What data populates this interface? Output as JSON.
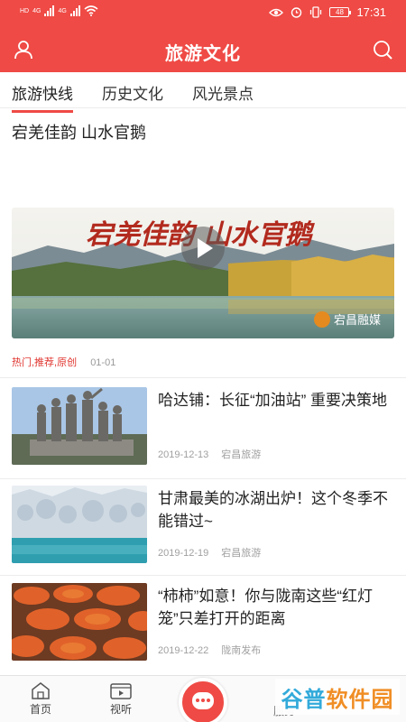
{
  "status": {
    "carrier_left": "HD",
    "net1": "4G",
    "net2": "4G",
    "battery": "48",
    "time": "17:31"
  },
  "header": {
    "title": "旅游文化",
    "left_icon": "user-icon",
    "right_icon": "search-icon"
  },
  "tabs": [
    {
      "label": "旅游快线",
      "active": true
    },
    {
      "label": "历史文化",
      "active": false
    },
    {
      "label": "风光景点",
      "active": false
    }
  ],
  "featured": {
    "title": "宕羌佳韵 山水官鹅",
    "banner_text": "宕羌佳韵 山水官鹅",
    "watermark": "宕昌融媒",
    "tags": "热门,推荐,原创",
    "date": "01-01"
  },
  "news": [
    {
      "title": "哈达铺：长征“加油站” 重要决策地",
      "date": "2019-12-13",
      "source": "宕昌旅游",
      "thumb": "statues"
    },
    {
      "title": "甘肃最美的冰湖出炉！这个冬季不能错过~",
      "date": "2019-12-19",
      "source": "宕昌旅游",
      "thumb": "frozen-lake"
    },
    {
      "title": "“柿柿”如意！你与陇南这些“红灯笼”只差打开的距离",
      "date": "2019-12-22",
      "source": "陇南发布",
      "thumb": "persimmons"
    }
  ],
  "bottom_nav": [
    {
      "label": "首页",
      "icon": "home-icon"
    },
    {
      "label": "视听",
      "icon": "video-icon"
    },
    {
      "label": "服务",
      "icon": "service-icon"
    }
  ],
  "watermark": {
    "part1": "谷普",
    "part2": "软件园"
  },
  "colors": {
    "brand": "#ef4a45",
    "tag": "#e0352f"
  }
}
